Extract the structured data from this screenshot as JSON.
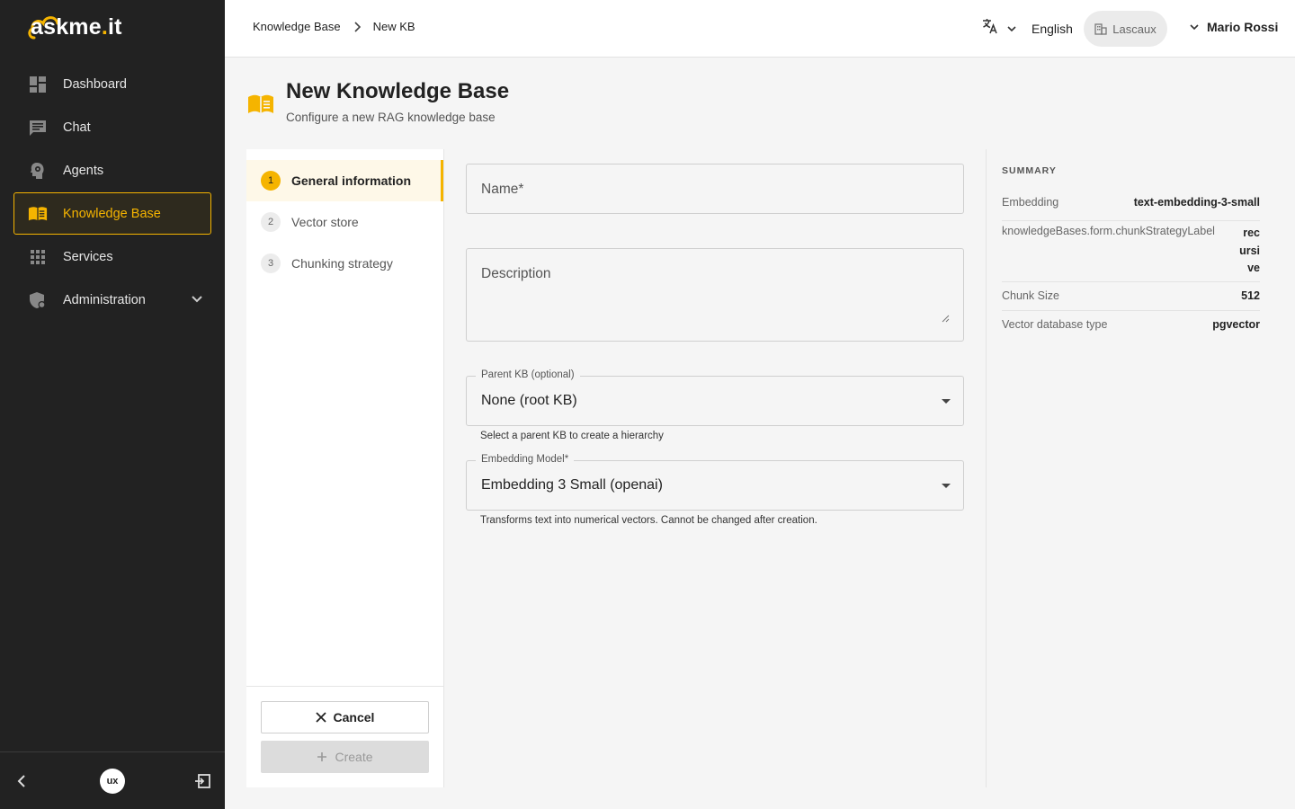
{
  "app": {
    "logo_main": "askme",
    "logo_dot": ".",
    "logo_tld": "it"
  },
  "sidebar": {
    "items": [
      {
        "label": "Dashboard",
        "icon": "dashboard-icon"
      },
      {
        "label": "Chat",
        "icon": "chat-icon"
      },
      {
        "label": "Agents",
        "icon": "agents-icon"
      },
      {
        "label": "Knowledge Base",
        "icon": "book-icon",
        "active": true
      },
      {
        "label": "Services",
        "icon": "grid-icon"
      },
      {
        "label": "Administration",
        "icon": "admin-shield-icon"
      }
    ],
    "footer_badge": "ux"
  },
  "topbar": {
    "breadcrumb": [
      "Knowledge Base",
      "New KB"
    ],
    "language": "English",
    "tenant": "Lascaux",
    "user": "Mario Rossi"
  },
  "page": {
    "title": "New Knowledge Base",
    "subtitle": "Configure a new RAG knowledge base"
  },
  "steps": [
    {
      "num": "1",
      "label": "General information",
      "active": true
    },
    {
      "num": "2",
      "label": "Vector store"
    },
    {
      "num": "3",
      "label": "Chunking strategy"
    }
  ],
  "actions": {
    "cancel": "Cancel",
    "create": "Create"
  },
  "form": {
    "name_placeholder": "Name*",
    "description_placeholder": "Description",
    "parent_label": "Parent KB (optional)",
    "parent_value": "None (root KB)",
    "parent_helper": "Select a parent KB to create a hierarchy",
    "embedding_label": "Embedding Model*",
    "embedding_value": "Embedding 3 Small (openai)",
    "embedding_helper": "Transforms text into numerical vectors. Cannot be changed after creation."
  },
  "summary": {
    "title": "SUMMARY",
    "rows": [
      {
        "key": "Embedding",
        "value": "text-embedding-3-small"
      },
      {
        "key": "knowledgeBases.form.chunkStrategyLabel",
        "value": "recursive"
      },
      {
        "key": "Chunk Size",
        "value": "512"
      },
      {
        "key": "Vector database type",
        "value": "pgvector"
      }
    ]
  },
  "colors": {
    "accent": "#f5b400",
    "sidebar_bg": "#222222"
  }
}
